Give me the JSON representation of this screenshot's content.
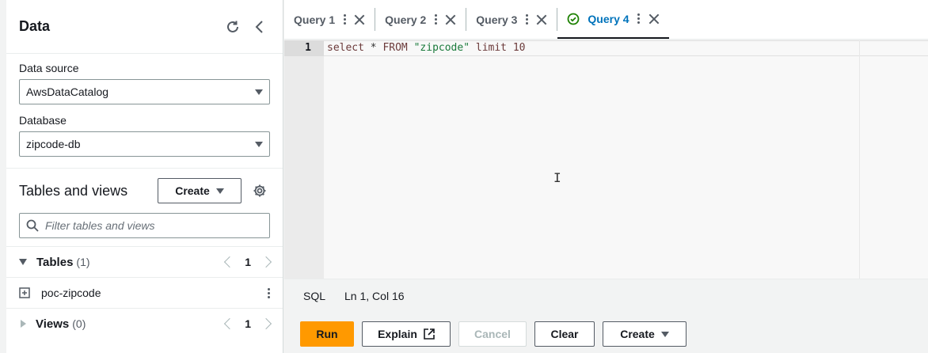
{
  "sidebar": {
    "title": "Data",
    "data_source_label": "Data source",
    "data_source_value": "AwsDataCatalog",
    "database_label": "Database",
    "database_value": "zipcode-db",
    "tables_views_title": "Tables and views",
    "create_label": "Create",
    "filter_placeholder": "Filter tables and views",
    "tables_group": {
      "name": "Tables",
      "count": "(1)",
      "page": "1"
    },
    "tables": [
      {
        "name": "poc-zipcode"
      }
    ],
    "views_group": {
      "name": "Views",
      "count": "(0)",
      "page": "1"
    }
  },
  "tabs": [
    {
      "label": "Query 1",
      "active": false
    },
    {
      "label": "Query 2",
      "active": false
    },
    {
      "label": "Query 3",
      "active": false
    },
    {
      "label": "Query 4",
      "active": true
    }
  ],
  "editor": {
    "line_number": "1",
    "tokens": {
      "t1": "select",
      "t2": " * ",
      "t3": "FROM",
      "t4": " ",
      "t5": "\"zipcode\"",
      "t6": " ",
      "t7": "limit",
      "t8": " ",
      "t9": "10"
    }
  },
  "status": {
    "language": "SQL",
    "cursor": "Ln 1, Col 16"
  },
  "actions": {
    "run": "Run",
    "explain": "Explain",
    "cancel": "Cancel",
    "clear": "Clear",
    "create": "Create"
  },
  "colors": {
    "accent": "#0073bb",
    "primary_button": "#ff9900",
    "success": "#1d8102"
  }
}
